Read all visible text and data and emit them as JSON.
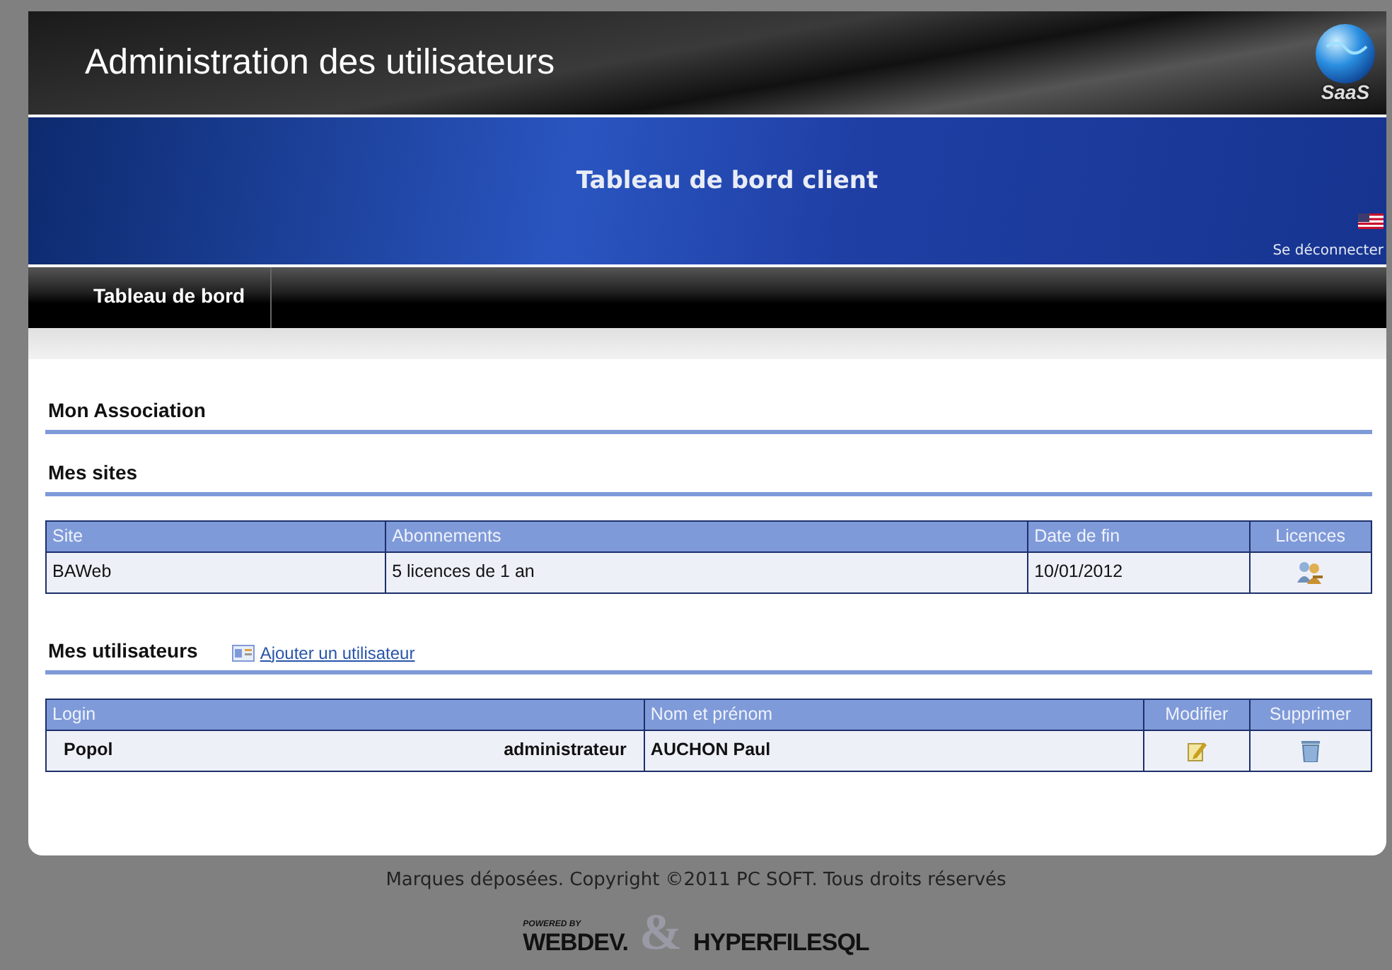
{
  "header": {
    "title": "Administration des utilisateurs",
    "logo_text": "SaaS"
  },
  "banner": {
    "title": "Tableau de bord client",
    "logout": "Se déconnecter"
  },
  "nav": [
    {
      "label": "Tableau de bord"
    }
  ],
  "sections": [
    {
      "title": "Mon Association"
    },
    {
      "title": "Mes sites",
      "table": {
        "columns": [
          {
            "label": "Site"
          },
          {
            "label": "Abonnements"
          },
          {
            "label": "Date de fin"
          },
          {
            "label": "Licences"
          }
        ],
        "rows": [
          [
            {
              "kind": "text",
              "text": "BAWeb"
            },
            {
              "kind": "text",
              "text": "5 licences de 1 an"
            },
            {
              "kind": "text",
              "text": "10/01/2012"
            },
            {
              "kind": "licences"
            }
          ]
        ]
      }
    },
    {
      "title": "Mes utilisateurs",
      "action": "Ajouter un utilisateur",
      "table": {
        "columns": [
          {
            "label": "Login"
          },
          {
            "label": "Nom et prénom"
          },
          {
            "label": "Modifier"
          },
          {
            "label": "Supprimer"
          }
        ],
        "rows": [
          [
            {
              "kind": "login",
              "text": "Popol",
              "role": "administrateur"
            },
            {
              "kind": "bold",
              "text": "AUCHON Paul"
            },
            {
              "kind": "edit"
            },
            {
              "kind": "delete"
            }
          ]
        ]
      }
    }
  ],
  "footer": {
    "copyright": "Marques déposées. Copyright ©2011 PC SOFT. Tous droits réservés",
    "powered": "POWERED BY",
    "brand_1": "WEBDEV.",
    "ampersand": "&",
    "brand_2": "HYPERFILESQL"
  }
}
